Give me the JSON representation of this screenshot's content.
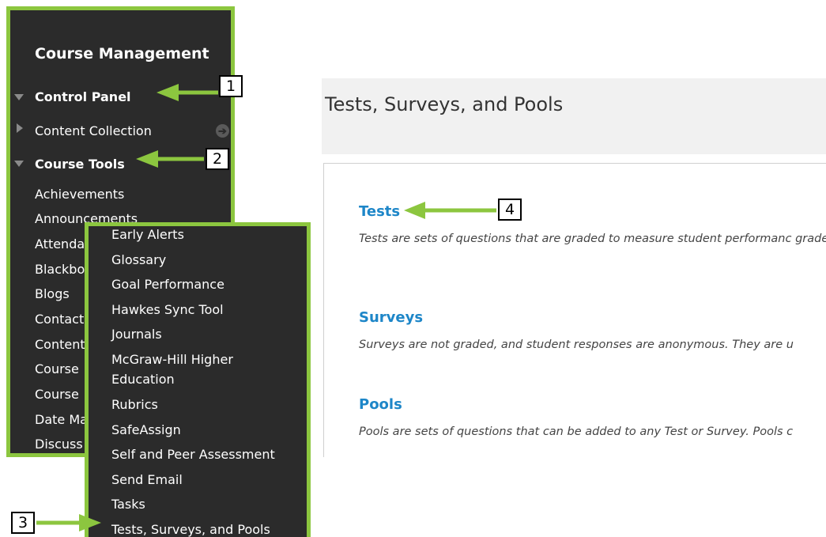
{
  "course_management": {
    "title": "Course Management",
    "control_panel": "Control Panel",
    "content_collection": "Content Collection",
    "course_tools": "Course Tools",
    "visible_items": [
      "Achievements",
      "Announcements",
      "Attenda",
      "Blackbo",
      "Blogs",
      "Contact",
      "Content",
      "Course",
      "Course",
      "Date Ma",
      "Discuss"
    ]
  },
  "course_tools_menu": {
    "items": [
      "Early Alerts",
      "Glossary",
      "Goal Performance",
      "Hawkes Sync Tool",
      "Journals",
      "McGraw-Hill Higher",
      "Education",
      "Rubrics",
      "SafeAssign",
      "Self and Peer Assessment",
      "Send Email",
      "Tasks",
      "Tests, Surveys, and Pools"
    ]
  },
  "page": {
    "title": "Tests, Surveys, and Pools",
    "sections": [
      {
        "label": "Tests",
        "description": "Tests are sets of questions that are graded to measure student performanc graded."
      },
      {
        "label": "Surveys",
        "description": "Surveys are not graded, and student responses are anonymous. They are u"
      },
      {
        "label": "Pools",
        "description": "Pools are sets of questions that can be added to any Test or Survey. Pools c"
      }
    ]
  },
  "callouts": [
    "1",
    "2",
    "3",
    "4"
  ],
  "colors": {
    "panel_bg": "#2b2b2b",
    "highlight_border": "#8cc63f",
    "link_blue": "#1d86c8",
    "arrow_green": "#8cc63f"
  }
}
